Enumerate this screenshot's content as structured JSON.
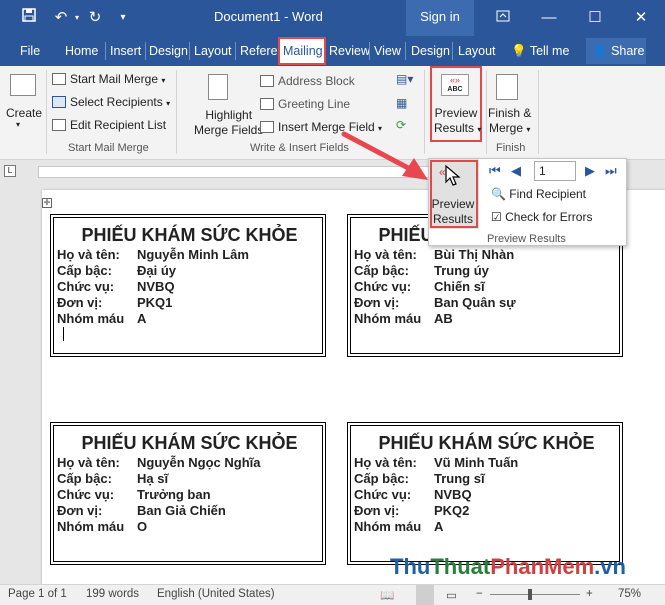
{
  "titlebar": {
    "document_title": "Document1 - Word",
    "sign_in": "Sign in"
  },
  "tabs": [
    "File",
    "Home",
    "Insert",
    "Design",
    "Layout",
    "Referen",
    "Mailing",
    "Review",
    "View",
    "Design",
    "Layout"
  ],
  "tell_me": "Tell me",
  "share": "Share",
  "ribbon": {
    "create": "Create",
    "start_mail_merge": "Start Mail Merge",
    "select_recipients": "Select Recipients",
    "edit_recipient_list": "Edit Recipient List",
    "group_start": "Start Mail Merge",
    "highlight_line1": "Highlight",
    "highlight_line2": "Merge Fields",
    "address_block": "Address Block",
    "greeting_line": "Greeting Line",
    "insert_merge_field": "Insert Merge Field",
    "group_write": "Write & Insert Fields",
    "preview_line1": "Preview",
    "preview_line2": "Results",
    "finish_line1": "Finish &",
    "finish_line2": "Merge",
    "group_finish": "Finish",
    "preview_icon_text": "ABC"
  },
  "popup": {
    "record_value": "1",
    "preview_line1": "Preview",
    "preview_line2": "Results",
    "find_recipient": "Find Recipient",
    "check_errors": "Check for Errors",
    "group_label": "Preview Results"
  },
  "cards": [
    {
      "title": "PHIẾU KHÁM SỨC KHỎE",
      "fields": [
        [
          "Họ và tên:",
          "Nguyễn Minh Lâm"
        ],
        [
          "Cấp bậc:",
          "Đại úy"
        ],
        [
          "Chức vụ:",
          "NVBQ"
        ],
        [
          "Đơn vị:",
          "PKQ1"
        ],
        [
          "Nhóm máu",
          "A"
        ]
      ]
    },
    {
      "title": "PHIẾU KHÁM SỨC KHỎE",
      "fields": [
        [
          "Họ và tên:",
          "Bùi Thị Nhàn"
        ],
        [
          "Cấp bậc:",
          "Trung úy"
        ],
        [
          "Chức vụ:",
          "Chiến sĩ"
        ],
        [
          "Đơn vị:",
          "Ban Quân sự"
        ],
        [
          "Nhóm máu",
          "AB"
        ]
      ]
    },
    {
      "title": "PHIẾU KHÁM SỨC KHỎE",
      "fields": [
        [
          "Họ và tên:",
          "Nguyễn Ngọc Nghĩa"
        ],
        [
          "Cấp bậc:",
          "Hạ sĩ"
        ],
        [
          "Chức vụ:",
          "Trưởng ban"
        ],
        [
          "Đơn vị:",
          "Ban Giả Chiến"
        ],
        [
          "Nhóm máu",
          "O"
        ]
      ]
    },
    {
      "title": "PHIẾU KHÁM SỨC KHỎE",
      "fields": [
        [
          "Họ và tên:",
          "Vũ Minh Tuấn"
        ],
        [
          "Cấp bậc:",
          "Trung sĩ"
        ],
        [
          "Chức vụ:",
          "NVBQ"
        ],
        [
          "Đơn vị:",
          "PKQ2"
        ],
        [
          "Nhóm máu",
          "A"
        ]
      ]
    }
  ],
  "status": {
    "page": "Page 1 of 1",
    "words": "199 words",
    "language": "English (United States)",
    "zoom": "75%"
  },
  "watermark": {
    "part1": "Thu",
    "part2": "Thuat",
    "part3": "PhanMem",
    "part4": ".vn"
  },
  "colors": {
    "word_blue": "#2b579a",
    "highlight_red": "#e04a4a",
    "arrow_red": "#e8474f"
  }
}
